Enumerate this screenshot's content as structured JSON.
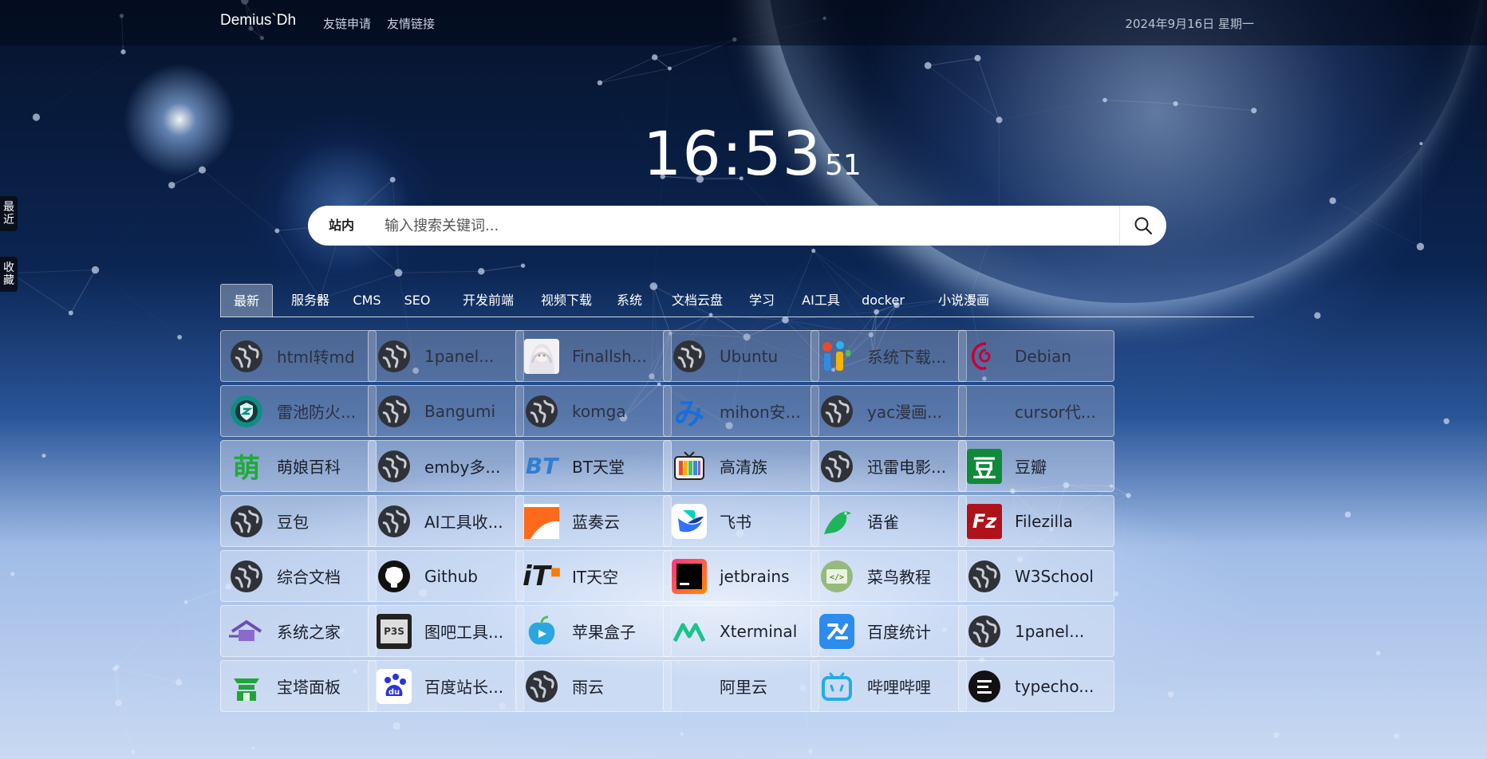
{
  "header": {
    "brand": "Demius`Dh",
    "links": [
      "友链申请",
      "友情链接"
    ],
    "date": "2024年9月16日 星期一"
  },
  "side": {
    "recent": "最近",
    "favorites": "收藏"
  },
  "clock": {
    "hm": "16:53",
    "sec": "51"
  },
  "search": {
    "scope": "站内",
    "placeholder": "输入搜索关键词..."
  },
  "tabs": [
    "最新",
    "服务器",
    "CMS",
    "SEO",
    "开发前端",
    "视频下载",
    "系统",
    "文档云盘",
    "学习",
    "AI工具",
    "docker",
    "小说漫画"
  ],
  "cards": [
    {
      "label": "html转md",
      "icon": "globe-icon"
    },
    {
      "label": "1panel...",
      "icon": "globe-icon"
    },
    {
      "label": "Finallsh...",
      "icon": "anime-avatar-icon"
    },
    {
      "label": "Ubuntu",
      "icon": "globe-icon"
    },
    {
      "label": "系统下载...",
      "icon": "colorful-i-icon"
    },
    {
      "label": "Debian",
      "icon": "debian-icon"
    },
    {
      "label": "雷池防火...",
      "icon": "safeline-shield-icon"
    },
    {
      "label": "Bangumi",
      "icon": "globe-icon"
    },
    {
      "label": "komga",
      "icon": "globe-icon"
    },
    {
      "label": "mihon安...",
      "icon": "mihon-mi-icon"
    },
    {
      "label": "yac漫画...",
      "icon": "globe-icon"
    },
    {
      "label": "cursor代...",
      "icon": "blank-icon"
    },
    {
      "label": "萌娘百科",
      "icon": "moe-icon"
    },
    {
      "label": "emby多...",
      "icon": "globe-icon"
    },
    {
      "label": "BT天堂",
      "icon": "bt-icon"
    },
    {
      "label": "高清族",
      "icon": "tv-icon"
    },
    {
      "label": "迅雷电影...",
      "icon": "globe-icon"
    },
    {
      "label": "豆瓣",
      "icon": "douban-icon"
    },
    {
      "label": "豆包",
      "icon": "globe-icon"
    },
    {
      "label": "AI工具收...",
      "icon": "globe-icon"
    },
    {
      "label": "蓝奏云",
      "icon": "lanzou-icon"
    },
    {
      "label": "飞书",
      "icon": "feishu-icon"
    },
    {
      "label": "语雀",
      "icon": "yuque-bird-icon"
    },
    {
      "label": "Filezilla",
      "icon": "filezilla-icon"
    },
    {
      "label": "综合文档",
      "icon": "globe-icon"
    },
    {
      "label": "Github",
      "icon": "github-icon"
    },
    {
      "label": "IT天空",
      "icon": "it-sky-icon"
    },
    {
      "label": "jetbrains",
      "icon": "jetbrains-icon"
    },
    {
      "label": "菜鸟教程",
      "icon": "runoob-icon"
    },
    {
      "label": "W3School",
      "icon": "globe-icon"
    },
    {
      "label": "系统之家",
      "icon": "system-home-icon"
    },
    {
      "label": "图吧工具...",
      "icon": "p3s-chip-icon"
    },
    {
      "label": "苹果盒子",
      "icon": "apple-box-icon"
    },
    {
      "label": "Xterminal",
      "icon": "xterminal-icon"
    },
    {
      "label": "百度统计",
      "icon": "baidu-tongji-icon"
    },
    {
      "label": "1panel...",
      "icon": "globe-icon"
    },
    {
      "label": "宝塔面板",
      "icon": "baota-icon"
    },
    {
      "label": "百度站长...",
      "icon": "baidu-paw-icon"
    },
    {
      "label": "雨云",
      "icon": "globe-icon"
    },
    {
      "label": "阿里云",
      "icon": "blank-icon"
    },
    {
      "label": "哔哩哔哩",
      "icon": "bilibili-icon"
    },
    {
      "label": "typecho...",
      "icon": "typecho-icon"
    }
  ],
  "icon_text": {
    "moe": "萌",
    "bt": "BT",
    "douban": "豆",
    "filezilla": "Fz",
    "it": "iT",
    "p3s": "P3S",
    "baidu": "du"
  },
  "colors": {
    "accent": "#1b1f2a",
    "topbar": "#04101a"
  }
}
